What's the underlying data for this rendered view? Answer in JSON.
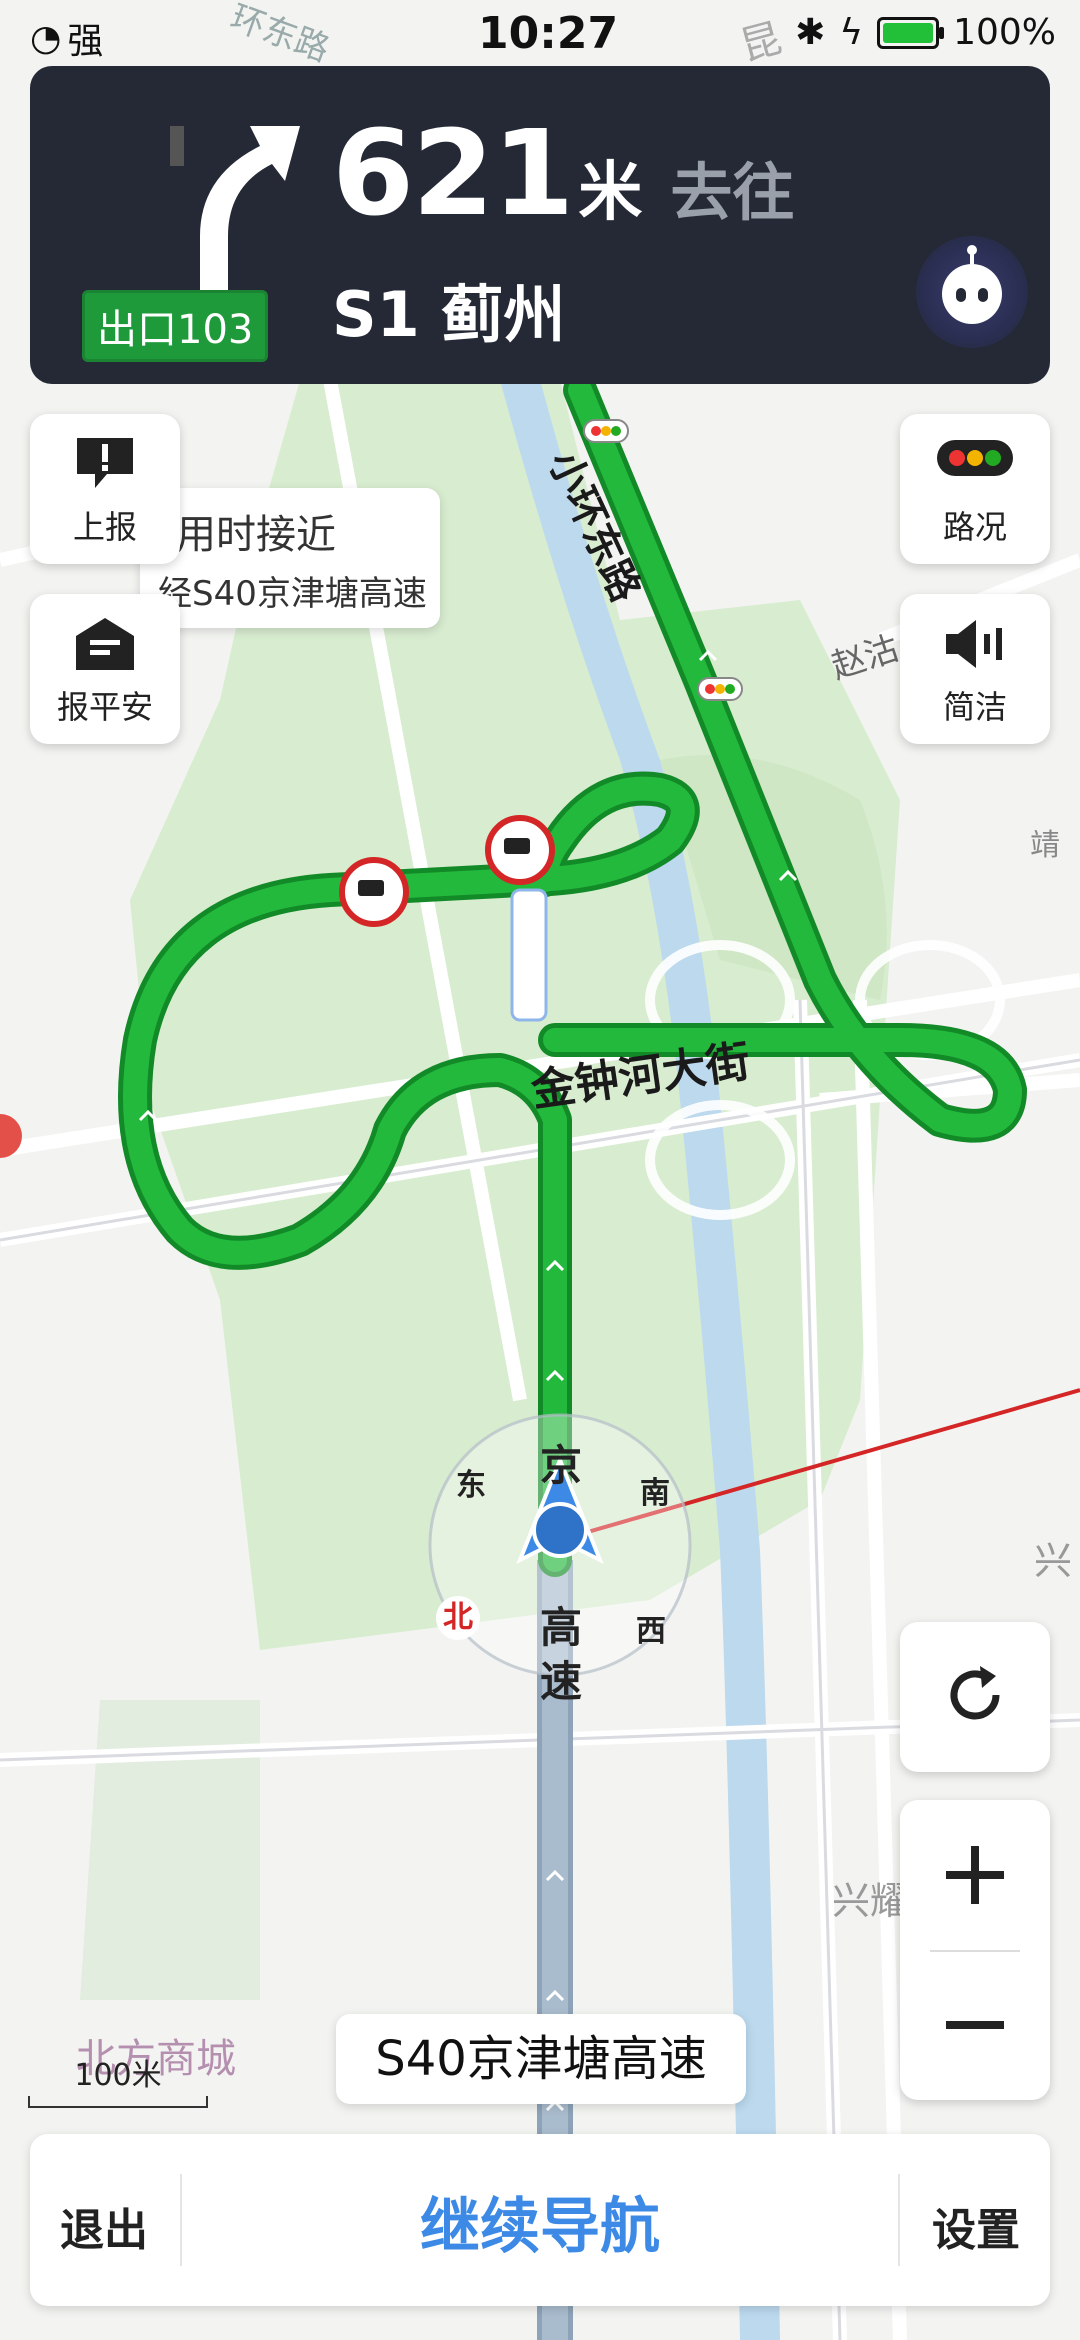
{
  "status_bar": {
    "signal_label": "强",
    "time": "10:27",
    "battery": "100%"
  },
  "guidance": {
    "exit": "出口103",
    "distance_value": "621",
    "distance_unit": "米",
    "go_to": "去往",
    "destination": "S1 蓟州",
    "turn_icon": "turn-right-arrow-icon"
  },
  "side_buttons": {
    "report": "上报",
    "safe": "报平安",
    "traffic": "路况",
    "voice": "简洁"
  },
  "eta_bubble": {
    "line1": "用时接近",
    "line2": "经S40京津塘高速"
  },
  "map_labels": {
    "road_top": "小环东路",
    "road_right": "赵沽",
    "road_far_right": "靖",
    "street": "金钟河大街",
    "place_right1": "兴",
    "place_right2": "兴耀",
    "place_bottom": "北方商城",
    "top_road": "环东路",
    "top_road2": "昆"
  },
  "compass": {
    "north": "北",
    "south": "南",
    "east": "东",
    "west": "西",
    "hw1": "京",
    "hw2": "高",
    "hw3": "速"
  },
  "current_road": "S40京津塘高速",
  "scale": "100米",
  "bottom_bar": {
    "exit": "退出",
    "continue": "继续导航",
    "settings": "设置"
  },
  "colors": {
    "route_green": "#1fae36",
    "card_dark": "#242935",
    "accent_blue": "#3c8ae6",
    "exit_green": "#1e9a3b"
  }
}
